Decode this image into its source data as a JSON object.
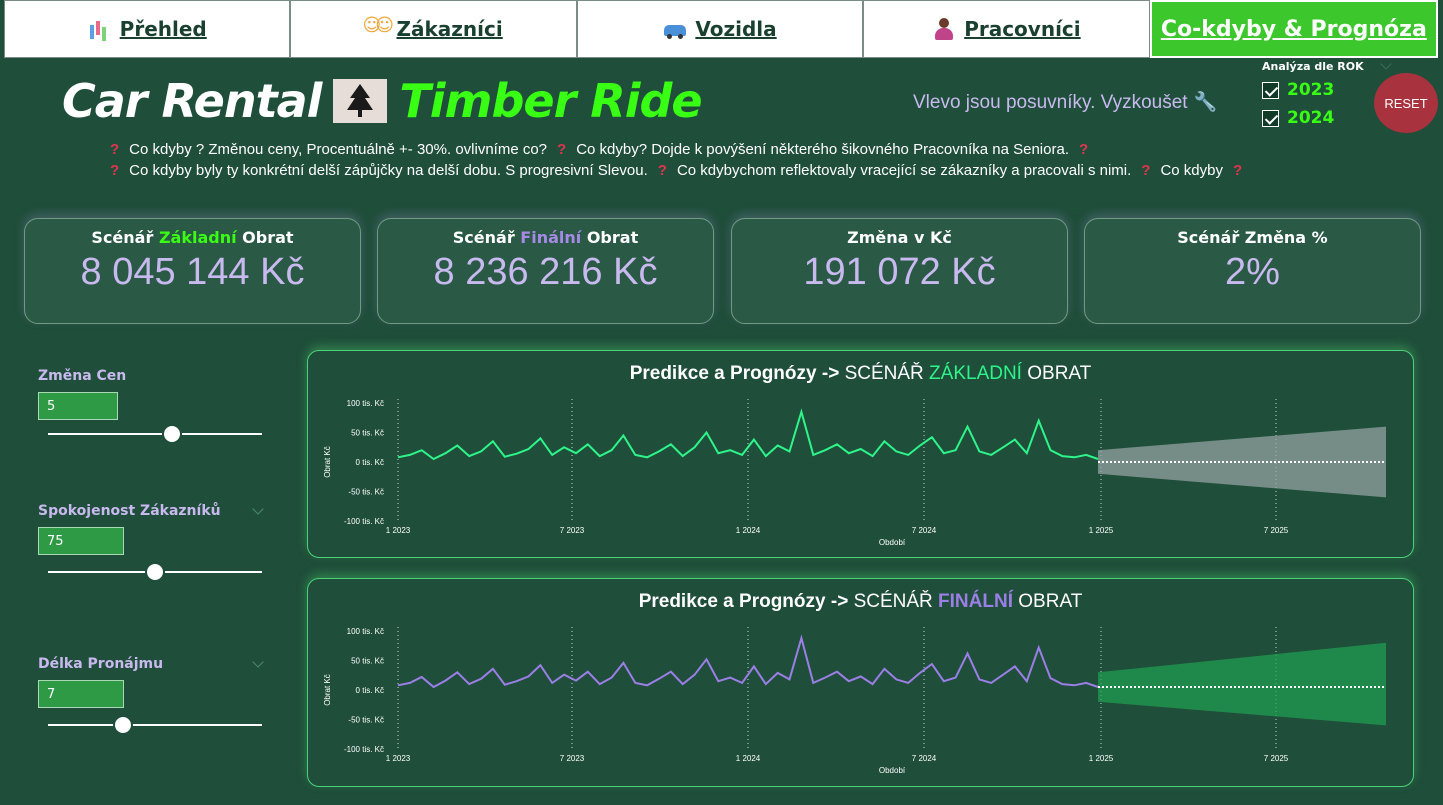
{
  "nav": {
    "tabs": [
      {
        "label": "Přehled",
        "icon": "bar-chart-icon"
      },
      {
        "label": "Zákazníci",
        "icon": "people-icon"
      },
      {
        "label": "Vozidla",
        "icon": "car-icon"
      },
      {
        "label": "Pracovníci",
        "icon": "worker-icon"
      },
      {
        "label": "Co-kdyby & Prognóza",
        "icon": "",
        "active": true
      }
    ]
  },
  "header": {
    "title_part1": "Car Rental",
    "title_part2": "Timber Ride",
    "hint": "Vlevo jsou posuvníky. Vyzkoušet",
    "questions_line1": [
      "Co kdyby ? Změnou ceny, Procentuálně +- 30%. ovlivníme co?",
      "Co kdyby? Dojde k povýšení některého šikovného Pracovníka na Seniora."
    ],
    "questions_line2": [
      "Co kdyby byly ty konkrétní delší zápůjčky na delší dobu. S progresivní Slevou.",
      "Co kdybychom reflektovaly vracející se zákazníky a pracovali s nimi.",
      "Co kdyby"
    ]
  },
  "filters": {
    "rok_title": "Analýza dle ROK",
    "years": [
      {
        "label": "2023",
        "checked": true
      },
      {
        "label": "2024",
        "checked": true
      }
    ],
    "reset_label": "RESET"
  },
  "kpis": {
    "k1": {
      "pre": "Scénář ",
      "hl": "Základní",
      "post": " Obrat",
      "value": "8 045 144 Kč"
    },
    "k2": {
      "pre": "Scénář ",
      "hl": "Finální",
      "post": " Obrat",
      "value": "8 236 216 Kč"
    },
    "k3": {
      "title": "Změna v Kč",
      "value": "191 072 Kč"
    },
    "k4": {
      "title": "Scénář Změna %",
      "value": "2%"
    }
  },
  "sliders": [
    {
      "label": "Změna Cen",
      "value": "5",
      "level": 0.58
    },
    {
      "label": "Spokojenost Zákazníků",
      "value": "75",
      "level": 0.5
    },
    {
      "label": "Délka Pronájmu",
      "value": "7",
      "level": 0.35
    }
  ],
  "charts": {
    "c1": {
      "title_bold": "Predikce a Prognózy ->",
      "title_pre": "SCÉNÁŘ",
      "title_hl": "ZÁKLADNÍ",
      "title_post": "OBRAT",
      "color": "#2ef58a",
      "band": "#9aa6a8"
    },
    "c2": {
      "title_bold": "Predikce a Prognózy ->",
      "title_pre": "SCÉNÁŘ",
      "title_hl": "FINÁLNÍ",
      "title_post": "OBRAT",
      "color": "#9b7fe6",
      "band": "#1fa352"
    }
  },
  "chart_data": [
    {
      "type": "line",
      "title": "Predikce a Prognózy -> SCÉNÁŘ ZÁKLADNÍ OBRAT",
      "xlabel": "Období",
      "ylabel": "Obrat Kč",
      "y_ticks": [
        "100 tis. Kč",
        "50 tis. Kč",
        "0 tis. Kč",
        "-50 tis. Kč",
        "-100 tis. Kč"
      ],
      "x_ticks": [
        "1 2023",
        "7 2023",
        "1 2024",
        "7 2024",
        "1 2025",
        "7 2025"
      ],
      "ylim": [
        -100000,
        100000
      ],
      "series": [
        {
          "values": [
            8000,
            12000,
            20000,
            5000,
            15000,
            28000,
            10000,
            18000,
            35000,
            9000,
            14000,
            22000,
            40000,
            12000,
            25000,
            15000,
            30000,
            10000,
            20000,
            45000,
            12000,
            8000,
            18000,
            30000,
            10000,
            25000,
            50000,
            15000,
            20000,
            12000,
            38000,
            10000,
            28000,
            18000,
            85000,
            12000,
            20000,
            30000,
            15000,
            22000,
            10000,
            35000,
            18000,
            12000,
            28000,
            42000,
            15000,
            20000,
            60000,
            18000,
            12000,
            25000,
            38000,
            15000,
            70000,
            20000,
            10000,
            8000,
            12000,
            5000
          ]
        }
      ],
      "forecast": {
        "mean": 0,
        "band_start": [
          -20000,
          20000
        ],
        "band_end": [
          -60000,
          60000
        ]
      }
    },
    {
      "type": "line",
      "title": "Predikce a Prognózy -> SCÉNÁŘ FINÁLNÍ OBRAT",
      "xlabel": "Období",
      "ylabel": "Obrat Kč",
      "y_ticks": [
        "100 tis. Kč",
        "50 tis. Kč",
        "0 tis. Kč",
        "-50 tis. Kč",
        "-100 tis. Kč"
      ],
      "x_ticks": [
        "1 2023",
        "7 2023",
        "1 2024",
        "7 2024",
        "1 2025",
        "7 2025"
      ],
      "ylim": [
        -100000,
        100000
      ],
      "series": [
        {
          "values": [
            8000,
            12000,
            22000,
            5000,
            16000,
            30000,
            10000,
            19000,
            36000,
            9000,
            15000,
            23000,
            42000,
            12000,
            26000,
            16000,
            31000,
            10000,
            21000,
            46000,
            12000,
            8000,
            19000,
            31000,
            10000,
            26000,
            52000,
            15000,
            21000,
            12000,
            40000,
            10000,
            29000,
            18000,
            88000,
            12000,
            21000,
            31000,
            15000,
            23000,
            10000,
            36000,
            18000,
            12000,
            29000,
            44000,
            15000,
            21000,
            62000,
            18000,
            12000,
            26000,
            40000,
            15000,
            72000,
            20000,
            10000,
            8000,
            12000,
            5000
          ]
        }
      ],
      "forecast": {
        "mean": 5000,
        "band_start": [
          -20000,
          30000
        ],
        "band_end": [
          -60000,
          80000
        ]
      }
    }
  ]
}
